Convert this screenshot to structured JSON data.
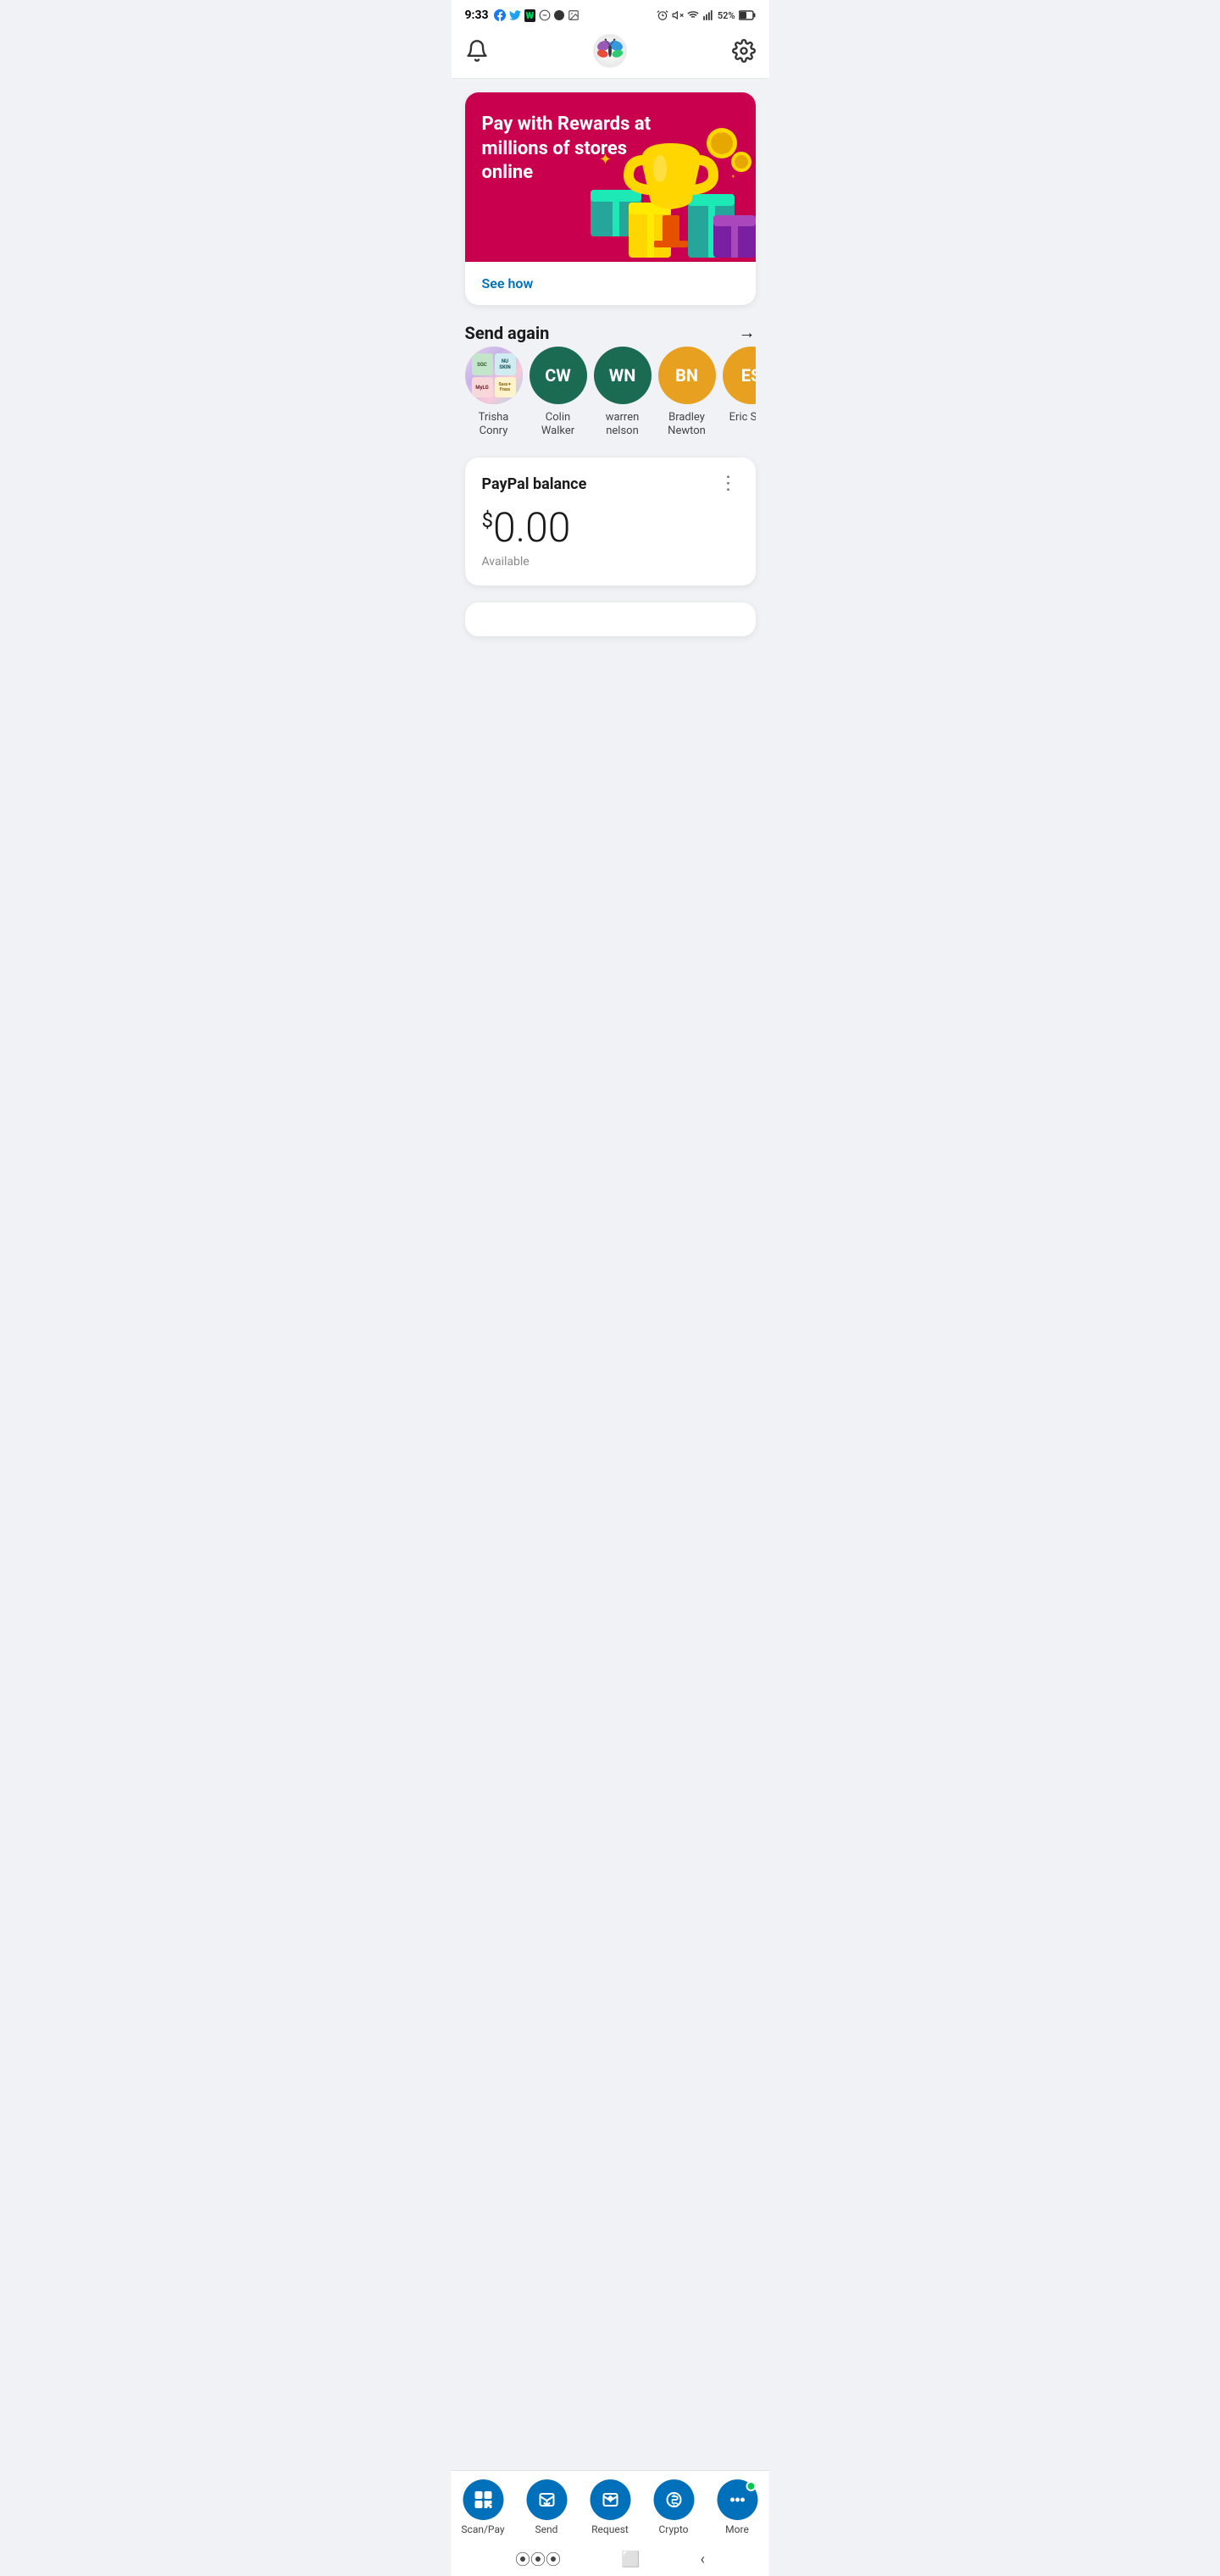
{
  "status_bar": {
    "time": "9:33",
    "battery": "52%"
  },
  "promo": {
    "title": "Pay with Rewards at millions of stores online",
    "cta": "See how"
  },
  "send_again": {
    "title": "Send again",
    "contacts": [
      {
        "initials": "",
        "name": "Trisha\nConry",
        "color": "avatar",
        "image": true
      },
      {
        "initials": "CW",
        "name": "Colin\nWalker",
        "color": "#1a6b52"
      },
      {
        "initials": "WN",
        "name": "warren\nnelson",
        "color": "#1a6b52"
      },
      {
        "initials": "BN",
        "name": "Bradley\nNewton",
        "color": "#e8a020"
      },
      {
        "initials": "ES",
        "name": "Eric Soto",
        "color": "#e8a020"
      }
    ]
  },
  "balance": {
    "title": "PayPal balance",
    "amount": "0.00",
    "currency_symbol": "$",
    "label": "Available"
  },
  "bottom_nav": {
    "items": [
      {
        "id": "scan-pay",
        "label": "Scan/Pay",
        "icon": "qr"
      },
      {
        "id": "send",
        "label": "Send",
        "icon": "send"
      },
      {
        "id": "request",
        "label": "Request",
        "icon": "request"
      },
      {
        "id": "crypto",
        "label": "Crypto",
        "icon": "crypto"
      },
      {
        "id": "more",
        "label": "More",
        "icon": "more",
        "has_dot": true
      }
    ]
  },
  "colors": {
    "primary": "#0070ba",
    "promo_bg": "#c8004e",
    "dark_green": "#1a6b52",
    "gold": "#e8a020"
  }
}
